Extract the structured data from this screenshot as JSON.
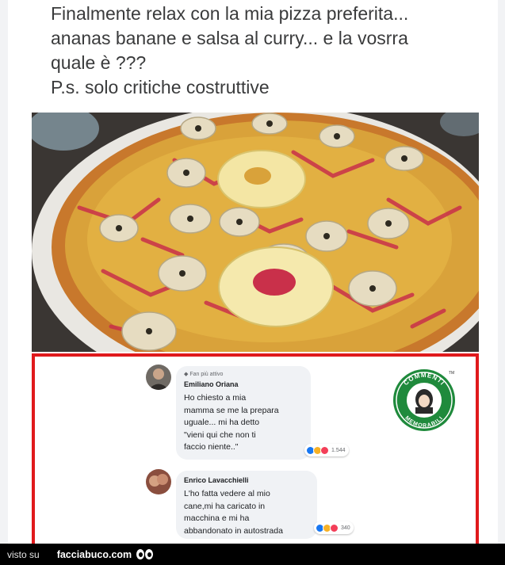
{
  "post": {
    "caption_lines": [
      "Finalmente relax con la mia pizza preferita...",
      "ananas banane e salsa al curry... e la vosrra",
      "quale è  ???",
      "P.s. solo critiche costruttive"
    ],
    "photo_icon": "pizza-photo"
  },
  "comments": [
    {
      "badge": "Fan più attivo",
      "author": "Emiliano Oriana",
      "text_lines": [
        "Ho chiesto a mia",
        "mamma se me la prepara",
        "uguale... mi ha detto",
        "\"vieni qui che non ti",
        "faccio niente..\""
      ],
      "reaction_count": "1.544"
    },
    {
      "author": "Enrico Lavacchielli",
      "text_lines": [
        "L'ho fatta vedere al mio",
        "cane,mi ha caricato in",
        "macchina e mi ha",
        "abbandonato in autostrada"
      ],
      "reaction_count": "340"
    }
  ],
  "logo": {
    "top_text": "COMMENTI",
    "bottom_text": "MEMORABILI",
    "tm": "TM",
    "color": "#1f8a3c"
  },
  "footer": {
    "visto_su": "visto su",
    "site": "facciabuco.com"
  },
  "colors": {
    "frame": "#e0191c",
    "like": "#1877f2",
    "laugh": "#f7b125",
    "love": "#f33e58"
  }
}
